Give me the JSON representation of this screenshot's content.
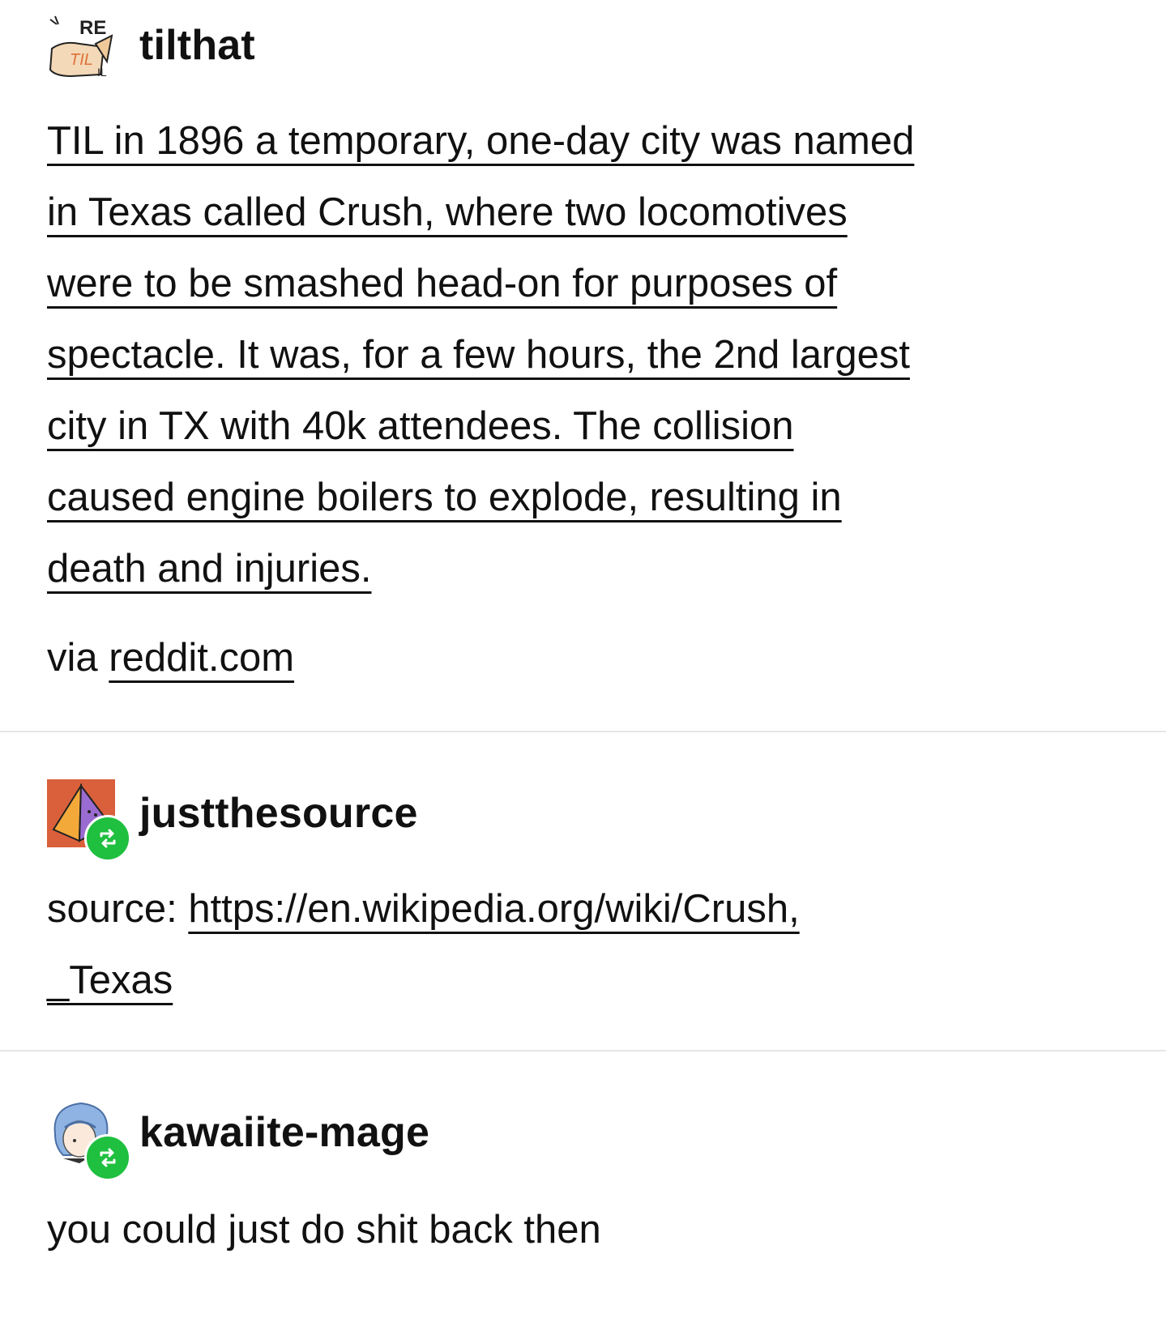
{
  "posts": [
    {
      "username": "tilthat",
      "avatar_icon": "til-logo-icon",
      "lines": [
        "TIL in 1896 a temporary, one-day city was named",
        "in Texas called Crush, where two locomotives",
        "were to be smashed head-on for purposes of",
        "spectacle. It was, for a few hours, the 2nd largest",
        "city in TX with 40k attendees. The collision",
        "caused engine boilers to explode, resulting in",
        "death and injuries."
      ],
      "via_prefix": "via ",
      "via_link": "reddit.com"
    },
    {
      "username": "justthesource",
      "avatar_icon": "pyramid-avatar-icon",
      "reblog_icon": "reblog-icon",
      "source_prefix": "source: ",
      "source_link_line1": "https://en.wikipedia.org/wiki/Crush,",
      "source_link_line2": "_Texas"
    },
    {
      "username": "kawaiite-mage",
      "avatar_icon": "anime-character-avatar-icon",
      "reblog_icon": "reblog-icon",
      "text": "you could just do shit back then"
    }
  ],
  "colors": {
    "reblog_green": "#1fbf3f",
    "avatar_orange": "#d9603b",
    "divider": "#e6e6e6"
  }
}
